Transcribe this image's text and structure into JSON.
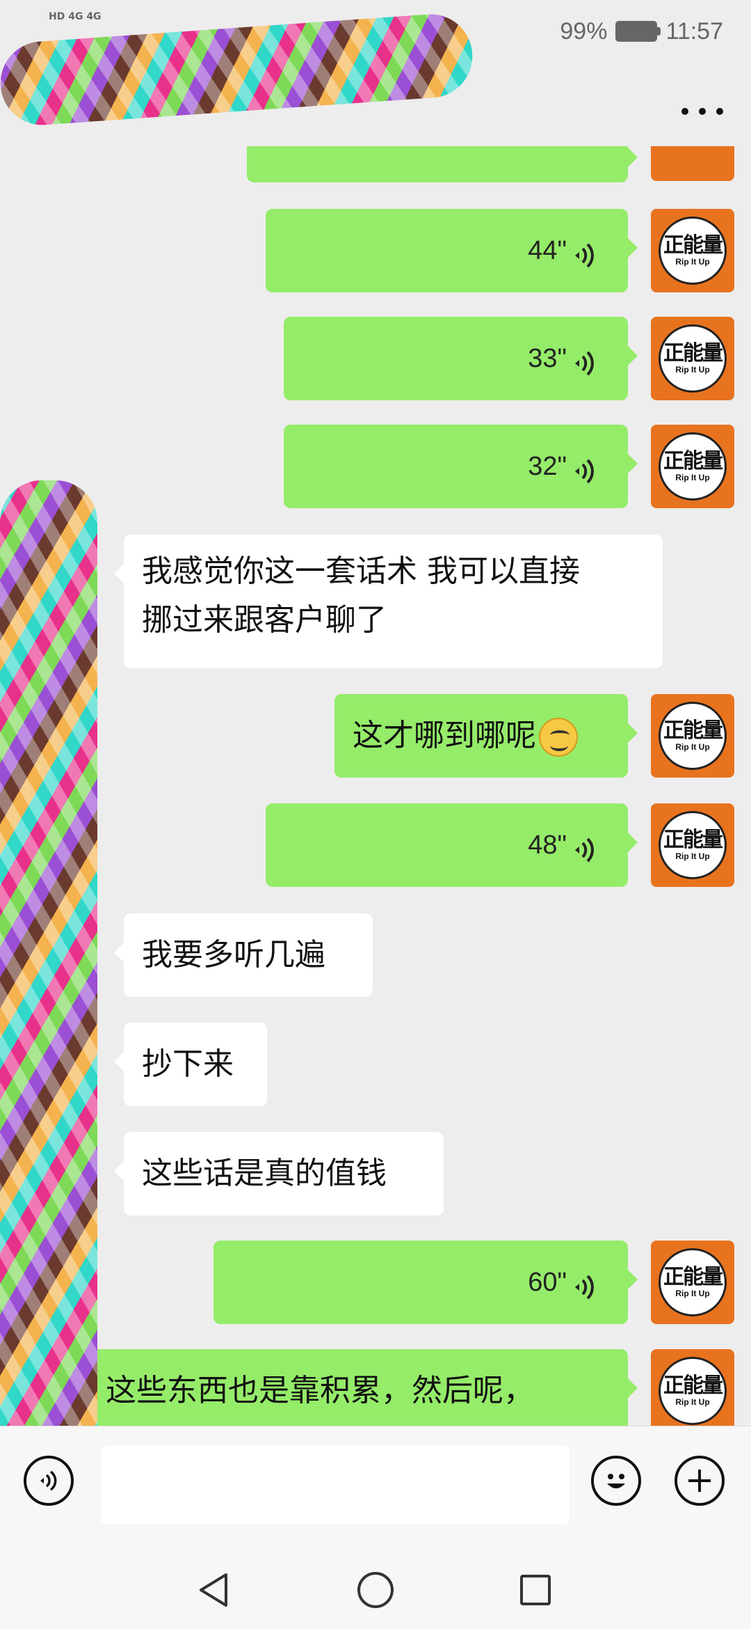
{
  "status_bar": {
    "network_left": "HD 4G 4G",
    "battery_percent": "99%",
    "time": "11:57"
  },
  "header": {
    "more_icon": "more-horizontal-icon"
  },
  "avatar_me": {
    "line1": "正能量",
    "line2": "Rip It Up"
  },
  "messages": [
    {
      "sender": "me",
      "type": "voice",
      "duration": "44\""
    },
    {
      "sender": "me",
      "type": "voice",
      "duration": "33\""
    },
    {
      "sender": "me",
      "type": "voice",
      "duration": "32\""
    },
    {
      "sender": "them",
      "type": "text",
      "text_line1": "我感觉你这一套话术 我可以直接",
      "text_line2": "挪过来跟客户聊了"
    },
    {
      "sender": "me",
      "type": "text",
      "text": "这才哪到哪呢",
      "emoji": "smirk-emoji-icon"
    },
    {
      "sender": "me",
      "type": "voice",
      "duration": "48\""
    },
    {
      "sender": "them",
      "type": "text",
      "text": "我要多听几遍"
    },
    {
      "sender": "them",
      "type": "text",
      "text": "抄下来"
    },
    {
      "sender": "them",
      "type": "text",
      "text": "这些话是真的值钱"
    },
    {
      "sender": "me",
      "type": "voice",
      "duration": "60\""
    },
    {
      "sender": "me",
      "type": "text",
      "text": "这些东西也是靠积累，然后呢，"
    }
  ],
  "input_bar": {
    "voice_icon": "voice-input-icon",
    "emoji_icon": "emoji-icon",
    "plus_icon": "plus-icon",
    "placeholder": ""
  },
  "nav_bar": {
    "back_icon": "back-triangle-icon",
    "home_icon": "home-circle-icon",
    "recents_icon": "recents-square-icon"
  }
}
